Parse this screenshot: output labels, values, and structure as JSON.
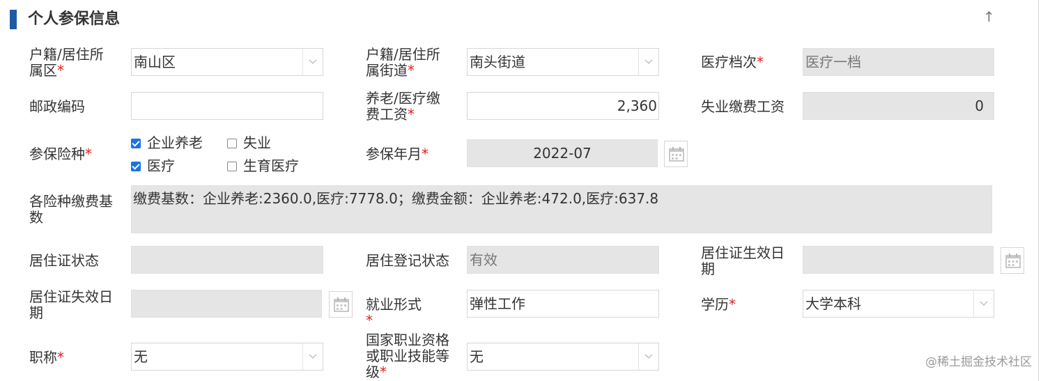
{
  "section": {
    "title": "个人参保信息",
    "collapse_icon": "↑"
  },
  "fields": {
    "huji_qu": {
      "label": "户籍/居住所属区",
      "value": "南山区"
    },
    "huji_jiedao": {
      "label": "户籍/居住所属街道",
      "value": "南头街道"
    },
    "yiliao_dangci": {
      "label": "医疗档次",
      "value": "医疗一档"
    },
    "youzheng": {
      "label": "邮政编码",
      "value": ""
    },
    "yanglao_gongzi": {
      "label": "养老/医疗缴费工资",
      "value": "2,360"
    },
    "shiye_gongzi": {
      "label": "失业缴费工资",
      "value": "0"
    },
    "canbao_xianzhong": {
      "label": "参保险种",
      "options": [
        {
          "label": "企业养老",
          "checked": true
        },
        {
          "label": "失业",
          "checked": false
        },
        {
          "label": "医疗",
          "checked": true
        },
        {
          "label": "生育医疗",
          "checked": false
        }
      ]
    },
    "canbao_nianyue": {
      "label": "参保年月",
      "value": "2022-07"
    },
    "jiaofei_jishu": {
      "label": "各险种缴费基数",
      "value": "缴费基数：企业养老:2360.0,医疗:7778.0；缴费金额：企业养老:472.0,医疗:637.8"
    },
    "juzhuzheng_zhuangtai": {
      "label": "居住证状态",
      "value": ""
    },
    "juzhu_dengji": {
      "label": "居住登记状态",
      "value": "有效"
    },
    "juzhuzheng_shengxiao": {
      "label": "居住证生效日期",
      "value": ""
    },
    "juzhuzheng_shixiao": {
      "label": "居住证失效日期",
      "value": ""
    },
    "jiuye_xingshi": {
      "label": "就业形式",
      "value": "弹性工作"
    },
    "xueli": {
      "label": "学历",
      "value": "大学本科"
    },
    "zhicheng": {
      "label": "职称",
      "value": "无"
    },
    "zhiye_zige": {
      "label": "国家职业资格或职业技能等级",
      "value": "无"
    }
  },
  "required_mark": "*",
  "watermark": "@稀土掘金技术社区"
}
